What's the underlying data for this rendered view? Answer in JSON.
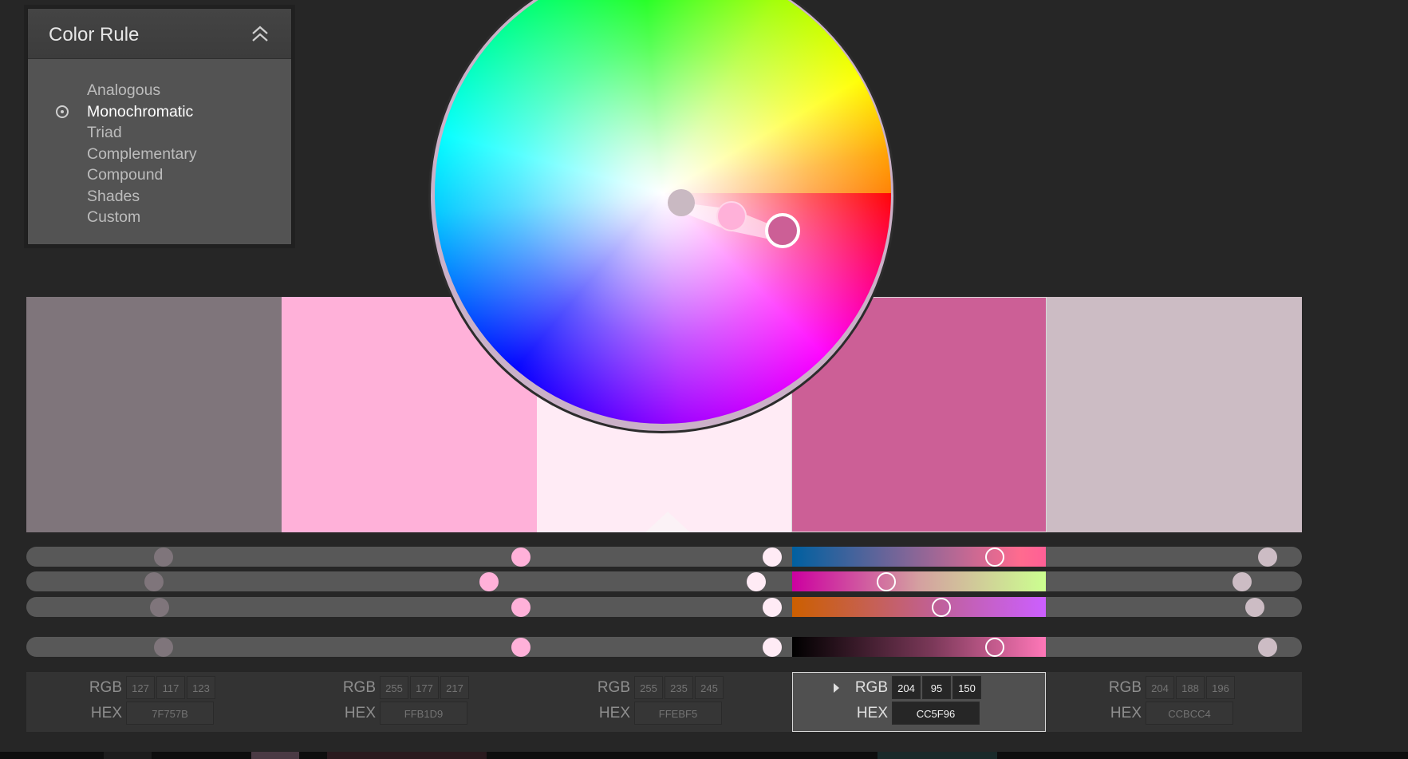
{
  "color_rule": {
    "title": "Color Rule",
    "options": [
      "Analogous",
      "Monochromatic",
      "Triad",
      "Complementary",
      "Compound",
      "Shades",
      "Custom"
    ],
    "selected": "Monochromatic"
  },
  "swatches": [
    {
      "hex": "7F757B",
      "color": "#7f757b",
      "rgb": [
        "127",
        "117",
        "123"
      ]
    },
    {
      "hex": "FFB1D9",
      "color": "#ffb1d9",
      "rgb": [
        "255",
        "177",
        "217"
      ]
    },
    {
      "hex": "FFEBF5",
      "color": "#ffebf5",
      "rgb": [
        "255",
        "235",
        "245"
      ]
    },
    {
      "hex": "CC5F96",
      "color": "#cc5f96",
      "rgb": [
        "204",
        "95",
        "150"
      ]
    },
    {
      "hex": "CCBCC4",
      "color": "#ccbcc4",
      "rgb": [
        "204",
        "188",
        "196"
      ]
    }
  ],
  "active_swatch": 3,
  "base_swatch": 2,
  "labels": {
    "rgb": "RGB",
    "hex": "HEX"
  },
  "sliders": {
    "r": [
      127,
      255,
      255,
      204,
      204
    ],
    "g": [
      117,
      177,
      235,
      95,
      188
    ],
    "b": [
      123,
      217,
      245,
      150,
      196
    ],
    "brightness": [
      127,
      255,
      255,
      204,
      204
    ]
  }
}
